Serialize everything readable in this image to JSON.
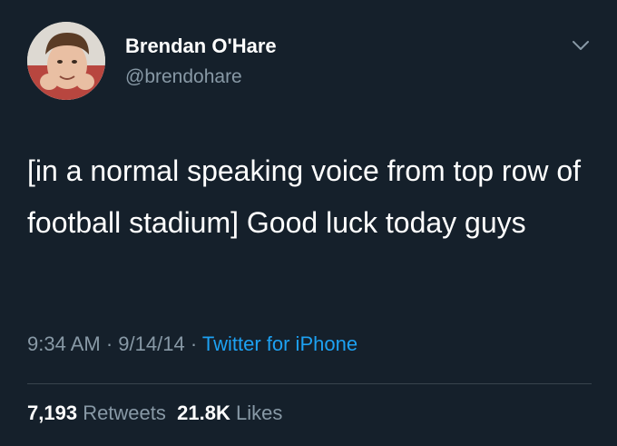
{
  "author": {
    "display_name": "Brendan O'Hare",
    "handle": "@brendohare"
  },
  "tweet": {
    "text": "[in a normal speaking voice from top row of football stadium] Good luck today guys",
    "time": "9:34 AM",
    "date": "9/14/14",
    "separator": "·",
    "source": "Twitter for iPhone"
  },
  "stats": {
    "retweets_count": "7,193",
    "retweets_label": "Retweets",
    "likes_count": "21.8K",
    "likes_label": "Likes"
  },
  "icons": {
    "chevron": "chevron-down-icon"
  },
  "colors": {
    "background": "#15202b",
    "secondary_text": "#8899a6",
    "link": "#1da1f2",
    "divider": "#38444d"
  }
}
